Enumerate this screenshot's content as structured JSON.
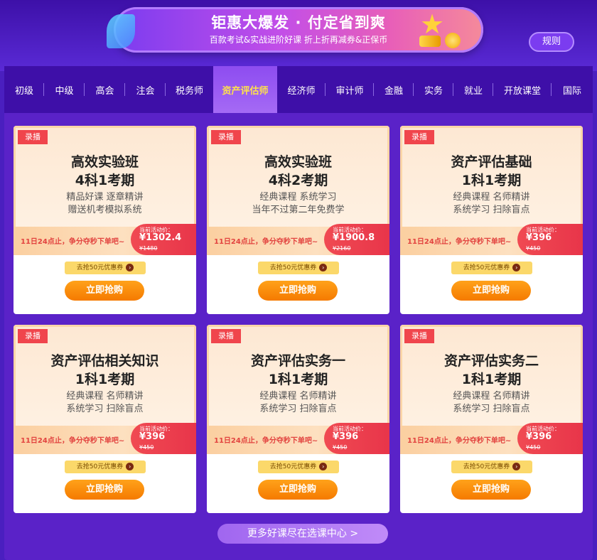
{
  "banner": {
    "title": "钜惠大爆发 · 付定省到爽",
    "subtitle": "百款考试&实战进阶好课 折上折再减券&正保币",
    "star_icon": "star-icon"
  },
  "rules_label": "规则",
  "tabs": [
    {
      "label": "初级",
      "active": false
    },
    {
      "label": "中级",
      "active": false
    },
    {
      "label": "高会",
      "active": false
    },
    {
      "label": "注会",
      "active": false
    },
    {
      "label": "税务师",
      "active": false
    },
    {
      "label": "资产评估师",
      "active": true
    },
    {
      "label": "经济师",
      "active": false
    },
    {
      "label": "审计师",
      "active": false
    },
    {
      "label": "金融",
      "active": false
    },
    {
      "label": "实务",
      "active": false
    },
    {
      "label": "就业",
      "active": false
    },
    {
      "label": "开放课堂",
      "active": false
    },
    {
      "label": "国际",
      "active": false
    }
  ],
  "cards": [
    {
      "tag": "录播",
      "title1": "高效实验班",
      "title2": "4科1考期",
      "desc1": "精品好课 逐章精讲",
      "desc2": "赠送机考模拟系统",
      "promo": "11日24点止，争分夺秒下单吧~",
      "price_label": "当前活动价：",
      "price": "¥1302.4",
      "old_price": "¥1480",
      "coupon": "去抢50元优惠券",
      "buy": "立即抢购"
    },
    {
      "tag": "录播",
      "title1": "高效实验班",
      "title2": "4科2考期",
      "desc1": "经典课程 系统学习",
      "desc2": "当年不过第二年免费学",
      "promo": "11日24点止，争分夺秒下单吧~",
      "price_label": "当前活动价：",
      "price": "¥1900.8",
      "old_price": "¥2160",
      "coupon": "去抢50元优惠券",
      "buy": "立即抢购"
    },
    {
      "tag": "录播",
      "title1": "资产评估基础",
      "title2": "1科1考期",
      "desc1": "经典课程 名师精讲",
      "desc2": "系统学习 扫除盲点",
      "promo": "11日24点止，争分夺秒下单吧~",
      "price_label": "当前活动价：",
      "price": "¥396",
      "old_price": "¥450",
      "coupon": "去抢50元优惠券",
      "buy": "立即抢购"
    },
    {
      "tag": "录播",
      "title1": "资产评估相关知识",
      "title2": "1科1考期",
      "desc1": "经典课程 名师精讲",
      "desc2": "系统学习 扫除盲点",
      "promo": "11日24点止，争分夺秒下单吧~",
      "price_label": "当前活动价：",
      "price": "¥396",
      "old_price": "¥450",
      "coupon": "去抢50元优惠券",
      "buy": "立即抢购"
    },
    {
      "tag": "录播",
      "title1": "资产评估实务一",
      "title2": "1科1考期",
      "desc1": "经典课程 名师精讲",
      "desc2": "系统学习 扫除盲点",
      "promo": "11日24点止，争分夺秒下单吧~",
      "price_label": "当前活动价：",
      "price": "¥396",
      "old_price": "¥450",
      "coupon": "去抢50元优惠券",
      "buy": "立即抢购"
    },
    {
      "tag": "录播",
      "title1": "资产评估实务二",
      "title2": "1科1考期",
      "desc1": "经典课程 名师精讲",
      "desc2": "系统学习 扫除盲点",
      "promo": "11日24点止，争分夺秒下单吧~",
      "price_label": "当前活动价：",
      "price": "¥396",
      "old_price": "¥450",
      "coupon": "去抢50元优惠券",
      "buy": "立即抢购"
    }
  ],
  "more_label": "更多好课尽在选课中心 >",
  "colors": {
    "background": "#4a1fbf",
    "tab_active_text": "#ffe24a",
    "price_red": "#f04a52",
    "buy_orange": "#f57a00"
  }
}
